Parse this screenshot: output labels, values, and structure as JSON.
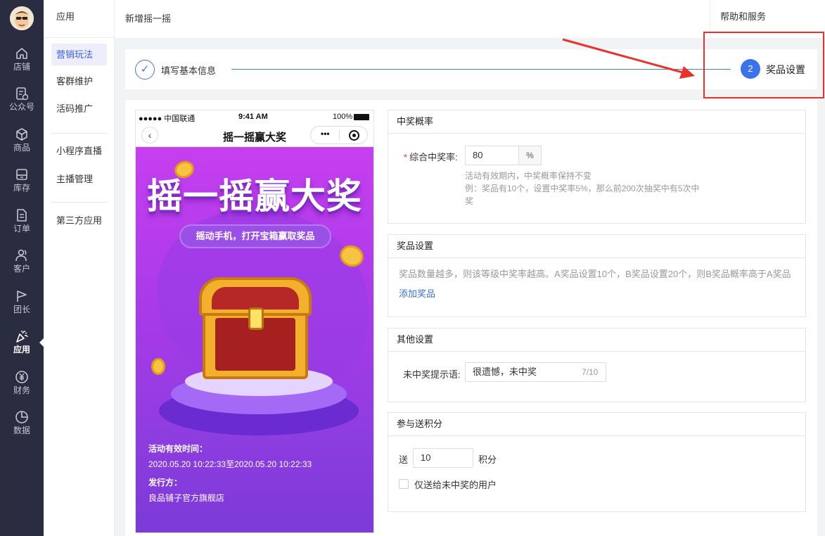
{
  "nav": {
    "items": [
      {
        "label": "店铺",
        "icon": "home-icon"
      },
      {
        "label": "公众号",
        "icon": "official-account-icon"
      },
      {
        "label": "商品",
        "icon": "box-icon"
      },
      {
        "label": "库存",
        "icon": "inventory-icon"
      },
      {
        "label": "订单",
        "icon": "order-icon"
      },
      {
        "label": "客户",
        "icon": "customer-icon"
      },
      {
        "label": "团长",
        "icon": "flag-icon"
      },
      {
        "label": "应用",
        "icon": "party-popper-icon"
      },
      {
        "label": "财务",
        "icon": "yen-icon"
      },
      {
        "label": "数据",
        "icon": "pie-chart-icon"
      }
    ],
    "active": "应用"
  },
  "sub_sidebar": {
    "title": "应用",
    "items": [
      "营销玩法",
      "客群维护",
      "活码推广",
      "小程序直播",
      "主播管理",
      "第三方应用"
    ],
    "active": "营销玩法"
  },
  "header": {
    "breadcrumb": "新增摇一摇",
    "help": "帮助和服务"
  },
  "steps": {
    "step1_check": "✓",
    "step1_label": "填写基本信息",
    "step2_number": "2",
    "step2_label": "奖品设置"
  },
  "preview": {
    "status_carrier": "●●●●● 中国联通",
    "status_time": "9:41 AM",
    "status_battery": "100%",
    "title": "摇一摇赢大奖",
    "back": "‹",
    "menu_dots": "•••",
    "banner_title": "摇一摇赢大奖",
    "pill_text": "摇动手机，打开宝箱赢取奖品",
    "time_label": "活动有效时间：",
    "time_value": "2020.05.20 10:22:33至2020.05.20 10:22:33",
    "issuer_label": "发行方：",
    "issuer_value": "良品铺子官方旗舰店"
  },
  "probability": {
    "header": "中奖概率",
    "required_mark": "*",
    "label": "综合中奖率:",
    "value": "80",
    "unit": "%",
    "hint_line1": "活动有效期内，中奖概率保持不变",
    "hint_line2": "例：奖品有10个，设置中奖率5%，那么前200次抽奖中有5次中",
    "hint_line3": "奖"
  },
  "prizes": {
    "header": "奖品设置",
    "hint": "奖品数量越多，则该等级中奖率越高。A奖品设置10个，B奖品设置20个，则B奖品概率高于A奖品",
    "add_link": "添加奖品"
  },
  "other": {
    "header": "其他设置",
    "label": "未中奖提示语:",
    "value": "很遗憾，未中奖",
    "counter": "7/10"
  },
  "points": {
    "header": "参与送积分",
    "prefix": "送",
    "value": "10",
    "suffix": "积分",
    "checkbox_label": "仅送给未中奖的用户"
  },
  "colors": {
    "nav_bg": "#2a2c3f",
    "accent": "#3a73ec",
    "annotation": "#e8322f"
  }
}
